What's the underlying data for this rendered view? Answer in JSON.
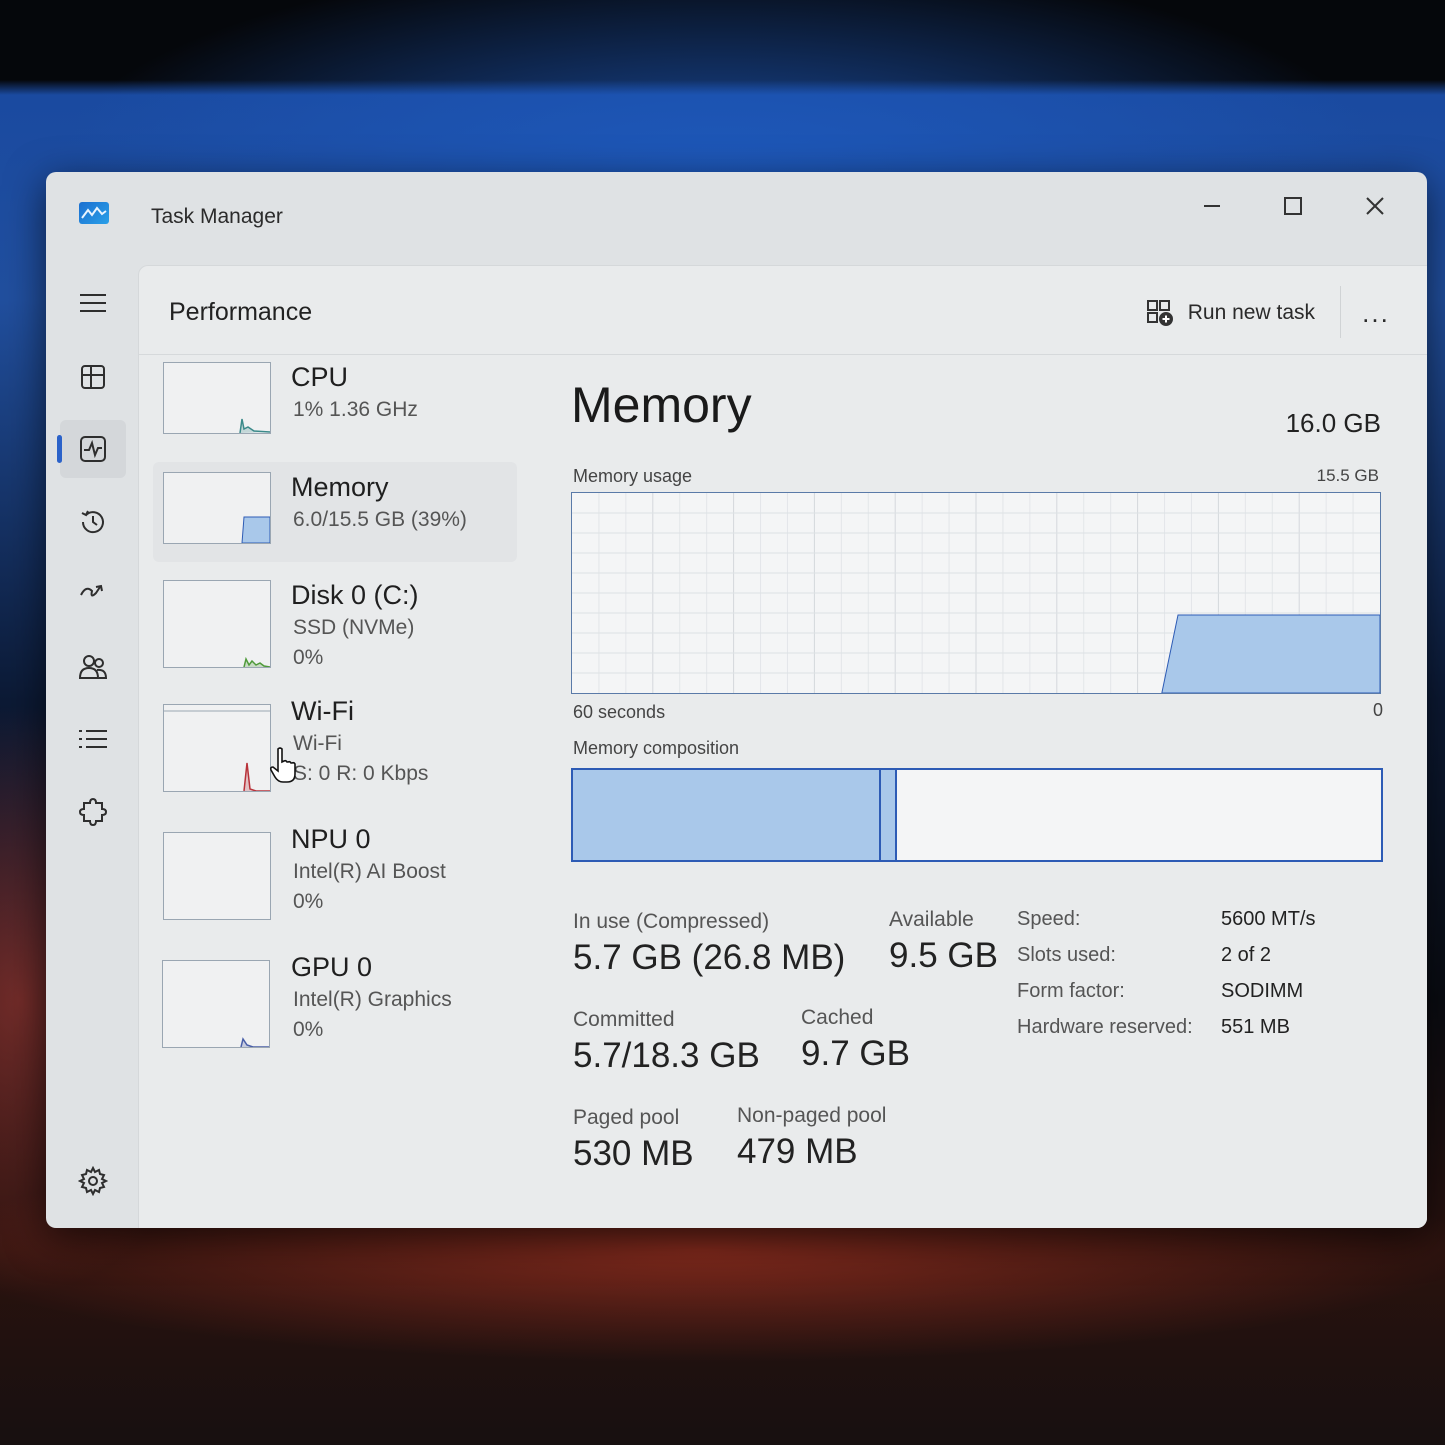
{
  "window": {
    "title": "Task Manager"
  },
  "header": {
    "page_title": "Performance",
    "run_new_task": "Run new task",
    "more": "..."
  },
  "nav": {
    "items": [
      "menu",
      "processes",
      "performance",
      "app-history",
      "startup-apps",
      "users",
      "details",
      "services",
      "settings"
    ],
    "active": "performance"
  },
  "devices": [
    {
      "name": "CPU",
      "line1": "1%  1.36 GHz",
      "line2": ""
    },
    {
      "name": "Memory",
      "line1": "6.0/15.5 GB (39%)",
      "line2": ""
    },
    {
      "name": "Disk 0 (C:)",
      "line1": "SSD (NVMe)",
      "line2": "0%"
    },
    {
      "name": "Wi-Fi",
      "line1": "Wi-Fi",
      "line2": "S: 0  R: 0 Kbps"
    },
    {
      "name": "NPU 0",
      "line1": "Intel(R) AI Boost",
      "line2": "0%"
    },
    {
      "name": "GPU 0",
      "line1": "Intel(R) Graphics",
      "line2": "0%"
    }
  ],
  "memory": {
    "title": "Memory",
    "total": "16.0 GB",
    "usage_label": "Memory usage",
    "usage_max": "15.5 GB",
    "time_left": "60 seconds",
    "time_right": "0",
    "composition_label": "Memory composition",
    "composition": {
      "in_use_fraction": 0.38,
      "modified_fraction": 0.02
    },
    "stats": {
      "in_use_label": "In use (Compressed)",
      "in_use_value": "5.7 GB (26.8 MB)",
      "available_label": "Available",
      "available_value": "9.5 GB",
      "committed_label": "Committed",
      "committed_value": "5.7/18.3 GB",
      "cached_label": "Cached",
      "cached_value": "9.7 GB",
      "paged_pool_label": "Paged pool",
      "paged_pool_value": "530 MB",
      "nonpaged_pool_label": "Non-paged pool",
      "nonpaged_pool_value": "479 MB"
    },
    "specs": [
      {
        "label": "Speed:",
        "value": "5600 MT/s"
      },
      {
        "label": "Slots used:",
        "value": "2 of 2"
      },
      {
        "label": "Form factor:",
        "value": "SODIMM"
      },
      {
        "label": "Hardware reserved:",
        "value": "551 MB"
      }
    ]
  },
  "colors": {
    "memory_fill": "#a9c8ea",
    "memory_line": "#2d5bb5",
    "cpu_line": "#3b8a8a",
    "disk_line": "#4f9a3a",
    "wifi_line": "#b8323a",
    "gpu_line": "#4a5fa8"
  }
}
